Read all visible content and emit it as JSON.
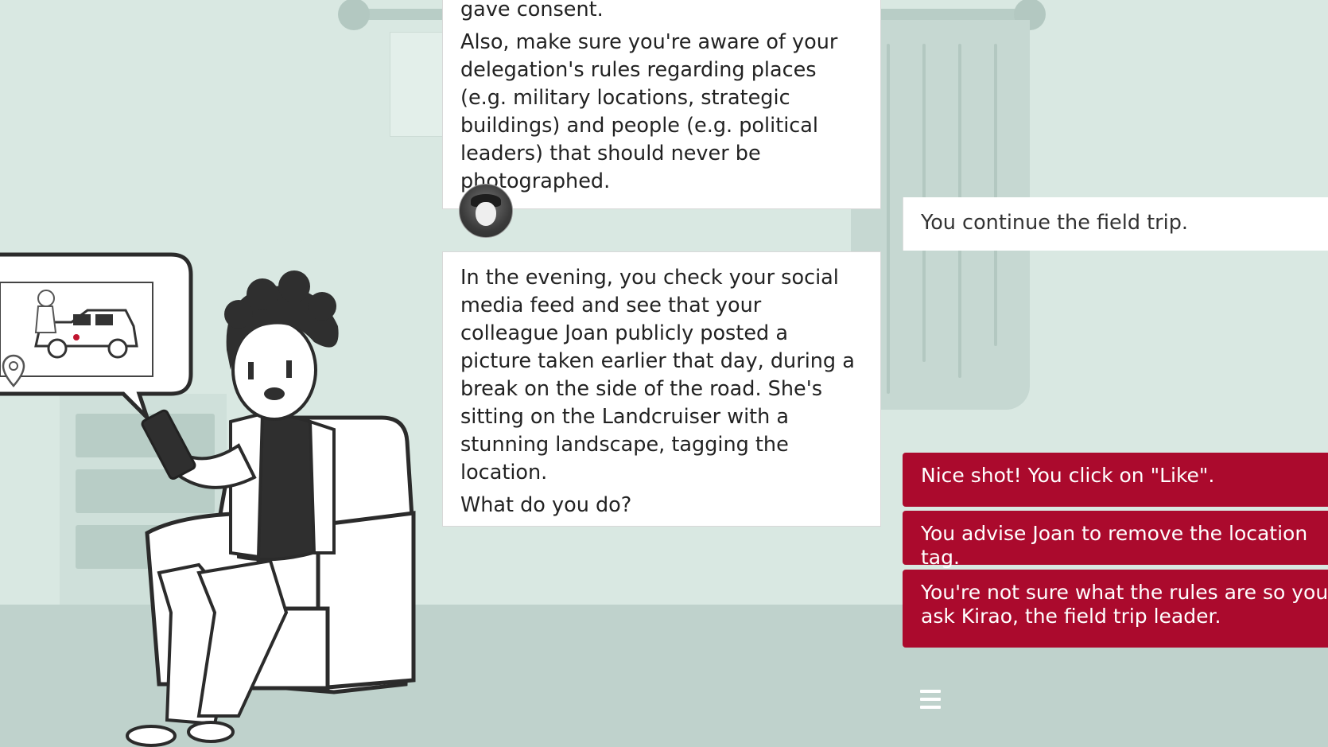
{
  "dialog": {
    "previous_lines": [
      "gave consent.",
      "Also, make sure you're aware of your delegation's rules regarding places (e.g. military locations, strategic buildings) and people (e.g. political leaders) that should never be photographed."
    ],
    "narration": [
      "In the evening, you check your social media feed and see that your colleague Joan publicly posted a picture taken earlier that day, during a break on the side of the road. She's sitting on the Landcruiser with a stunning landscape, tagging the location.",
      "What do you do?"
    ]
  },
  "status_message": "You continue the field trip.",
  "choices": [
    "Nice shot! You click on \"Like\".",
    "You advise Joan to remove the location tag.",
    "You're not sure what the rules are so you ask Kirao, the field trip leader."
  ],
  "icons": {
    "avatar": "speaker-avatar",
    "menu": "hamburger-menu-icon",
    "illustration": "woman-on-phone-illustration"
  },
  "colors": {
    "choice_background": "#ab0a2d",
    "scene_wall": "#d9e8e2",
    "scene_floor": "#bfd2cc"
  }
}
